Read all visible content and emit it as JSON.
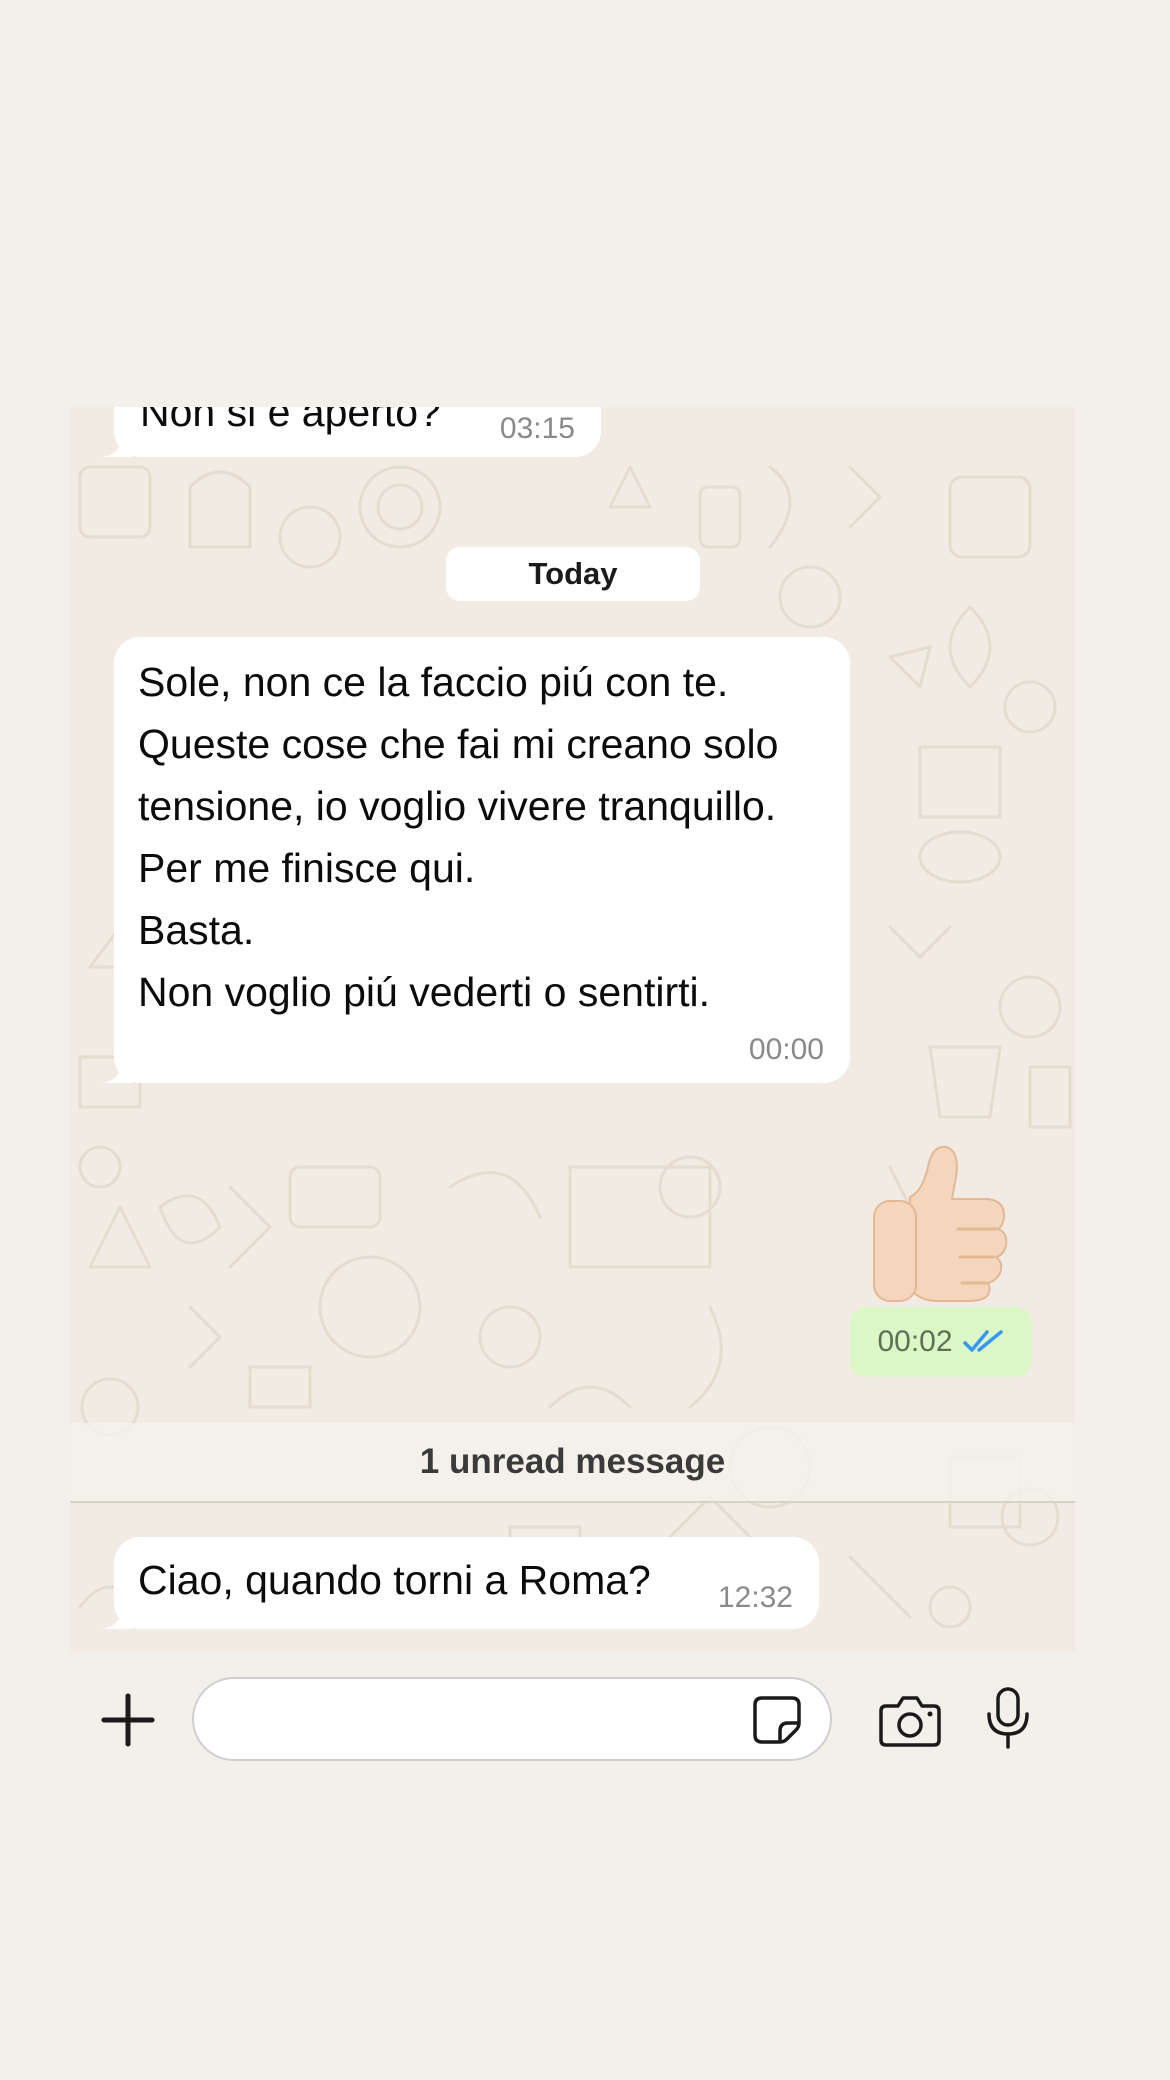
{
  "chat": {
    "previous_message": {
      "text": "Non si è aperto?",
      "time": "03:15"
    },
    "day_separator": "Today",
    "messages": [
      {
        "direction": "incoming",
        "lines": [
          "Sole, non ce la faccio piú con te.",
          "Queste cose che fai mi creano solo",
          "tensione, io voglio vivere tranquillo.",
          "Per me finisce qui.",
          "Basta.",
          "Non voglio piú vederti o sentirti."
        ],
        "time": "00:00"
      },
      {
        "direction": "outgoing",
        "content": "thumbs-up emoji",
        "time": "00:02",
        "status": "read"
      }
    ],
    "unread_separator": "1 unread message",
    "new_message": {
      "text": "Ciao, quando torni a Roma?",
      "time": "12:32"
    }
  },
  "input_bar": {
    "icons": [
      "plus-icon",
      "sticker-icon",
      "camera-icon",
      "microphone-icon"
    ],
    "message_value": ""
  },
  "colors": {
    "background": "#f3f0ec",
    "chat_wallpaper": "#f1ebe3",
    "incoming_bubble": "#ffffff",
    "outgoing_bubble": "#dcf7c6",
    "read_ticks": "#3497f9",
    "timestamp": "#8a8a8a"
  }
}
